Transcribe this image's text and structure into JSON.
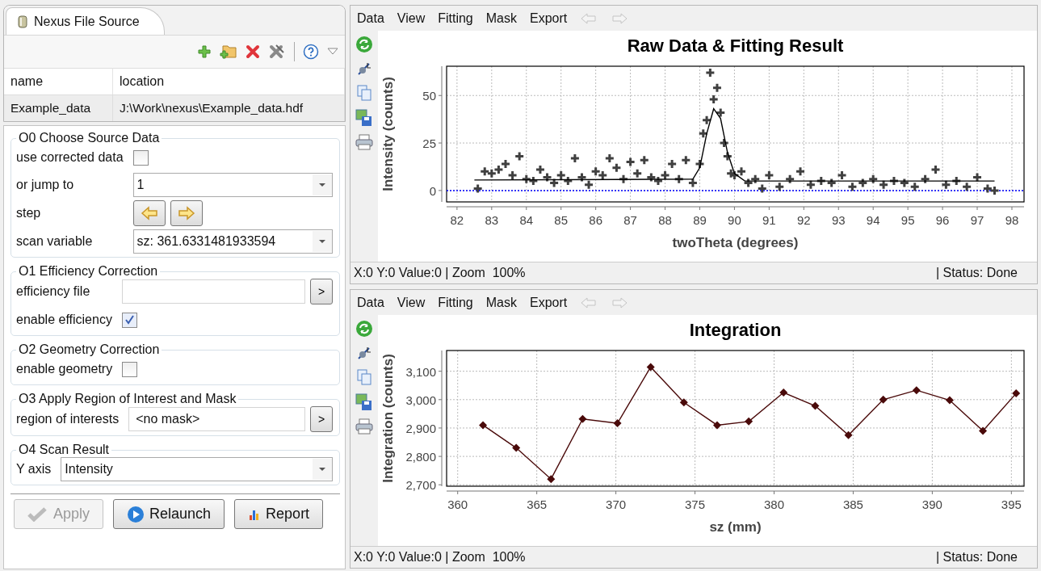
{
  "source_view": {
    "tab": "Nexus File Source",
    "table": {
      "columns": [
        "name",
        "location"
      ],
      "rows": [
        {
          "name": "Example_data",
          "location": "J:\\Work\\nexus\\Example_data.hdf"
        }
      ]
    }
  },
  "sections": [
    {
      "title": "O0 Choose Source Data",
      "fields": [
        {
          "kind": "checkbox",
          "label": "use corrected data",
          "checked": false
        },
        {
          "kind": "combo",
          "label": "or jump to",
          "value": "1"
        },
        {
          "kind": "stepper",
          "label": "step"
        },
        {
          "kind": "combo",
          "label": "scan variable",
          "value": "sz: 361.6331481933594"
        }
      ]
    },
    {
      "title": "O1 Efficiency Correction",
      "fields": [
        {
          "kind": "browse",
          "label": "efficiency file",
          "button": ">"
        },
        {
          "kind": "checkbox",
          "label": "enable efficiency",
          "checked": true
        }
      ]
    },
    {
      "title": "O2 Geometry Correction",
      "fields": [
        {
          "kind": "checkbox",
          "label": "enable geometry",
          "checked": false
        }
      ]
    },
    {
      "title": "O3 Apply Region of Interest and Mask",
      "fields": [
        {
          "kind": "browse",
          "label": "region of interests",
          "value": "<no mask>",
          "button": ">"
        }
      ]
    },
    {
      "title": "O4 Scan Result",
      "fields": [
        {
          "kind": "combo",
          "label": "Y axis",
          "value": "Intensity"
        }
      ]
    }
  ],
  "actions": [
    {
      "kind": "apply",
      "label": "Apply",
      "disabled": true
    },
    {
      "kind": "relaunch",
      "label": "Relaunch",
      "disabled": false
    },
    {
      "kind": "report",
      "label": "Report",
      "disabled": false
    }
  ],
  "plots": [
    {
      "menu": [
        "Data",
        "View",
        "Fitting",
        "Mask",
        "Export"
      ],
      "status_left": "X:0 Y:0 Value:0 | Zoom  100%",
      "status_right": "| Status: Done",
      "chart_data": {
        "type": "scatter",
        "title": "Raw Data & Fitting Result",
        "xlabel": "twoTheta (degrees)",
        "ylabel": "Intensity (counts)",
        "xlim": [
          81.7,
          98.35
        ],
        "ylim": [
          -6,
          65.4
        ],
        "xticks": [
          82,
          83,
          84,
          85,
          86,
          87,
          88,
          89,
          90,
          91,
          92,
          93,
          94,
          95,
          96,
          97,
          98
        ],
        "yticks": [
          0,
          25,
          50
        ],
        "grid": true,
        "series": [
          {
            "color": "#404040",
            "x": [
              82.6,
              82.8,
              83.0,
              83.2,
              83.4,
              83.6,
              83.8,
              84.0,
              84.2,
              84.4,
              84.6,
              84.8,
              85.0,
              85.2,
              85.4,
              85.6,
              85.8,
              86.0,
              86.2,
              86.4,
              86.6,
              86.8,
              87.0,
              87.2,
              87.4,
              87.6,
              87.8,
              88.0,
              88.2,
              88.4,
              88.6,
              88.8,
              89.0,
              89.1,
              89.2,
              89.3,
              89.4,
              89.5,
              89.6,
              89.7,
              89.8,
              89.9,
              90.0,
              90.2,
              90.4,
              90.6,
              90.8,
              91.0,
              91.3,
              91.6,
              91.9,
              92.2,
              92.5,
              92.8,
              93.1,
              93.4,
              93.7,
              94.0,
              94.3,
              94.6,
              94.9,
              95.2,
              95.5,
              95.8,
              96.1,
              96.4,
              96.7,
              97.0,
              97.3,
              97.5
            ],
            "values": [
              1,
              10,
              9,
              11,
              14,
              8,
              18,
              6,
              5,
              11,
              7,
              4,
              8,
              5,
              17,
              7,
              3,
              10,
              8,
              17,
              12,
              6,
              15,
              9,
              16,
              7,
              5,
              8,
              14,
              6,
              16,
              4,
              14,
              30,
              37,
              62,
              48,
              54,
              41,
              25,
              18,
              9,
              8,
              10,
              4,
              6,
              1,
              8,
              2,
              6,
              10,
              3,
              5,
              4,
              8,
              2,
              4,
              6,
              3,
              5,
              4,
              2,
              6,
              11,
              3,
              5,
              2,
              7,
              1,
              0
            ]
          },
          {
            "type": "line",
            "color": "#000000",
            "x": [
              82.5,
              88.8,
              89.0,
              89.2,
              89.4,
              89.6,
              89.8,
              90.0,
              90.3,
              97.5
            ],
            "values": [
              5.5,
              6,
              12,
              30,
              43,
              38,
              20,
              9,
              5,
              5
            ]
          }
        ],
        "ref_lines": [
          {
            "axis": "y",
            "value": 0,
            "color": "#0000ff"
          }
        ]
      }
    },
    {
      "menu": [
        "Data",
        "View",
        "Fitting",
        "Mask",
        "Export"
      ],
      "status_left": "X:0 Y:0 Value:0 | Zoom  100%",
      "status_right": "| Status: Done",
      "chart_data": {
        "type": "line",
        "title": "Integration",
        "xlabel": "sz (mm)",
        "ylabel": "Integration (counts)",
        "xlim": [
          359.3,
          395.8
        ],
        "ylim": [
          2695,
          3173
        ],
        "xticks": [
          360,
          365,
          370,
          375,
          380,
          385,
          390,
          395
        ],
        "yticks": [
          {
            "value": 2700,
            "label": "2,700"
          },
          {
            "value": 2800,
            "label": "2,800"
          },
          {
            "value": 2900,
            "label": "2,900"
          },
          {
            "value": 3000,
            "label": "3,000"
          },
          {
            "value": 3100,
            "label": "3,100"
          }
        ],
        "grid": true,
        "series": [
          {
            "color": "#4a0a0a",
            "marker": "diamond",
            "x": [
              361.6,
              363.7,
              365.9,
              367.9,
              370.1,
              372.2,
              374.3,
              376.4,
              378.4,
              380.6,
              382.6,
              384.7,
              386.9,
              389.0,
              391.1,
              393.2,
              395.3
            ],
            "values": [
              2910,
              2830,
              2720,
              2932,
              2917,
              3115,
              2990,
              2910,
              2923,
              3025,
              2978,
              2875,
              3000,
              3033,
              2998,
              2890,
              3022
            ]
          }
        ]
      }
    }
  ]
}
